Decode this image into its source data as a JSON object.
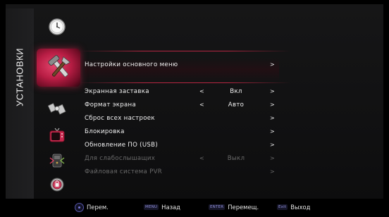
{
  "sidebar": {
    "title": "УСТАНОВКИ",
    "icons": [
      {
        "name": "clock-icon"
      },
      {
        "name": "tools-icon",
        "selected": true
      },
      {
        "name": "satellite-icon"
      },
      {
        "name": "tv-icon"
      },
      {
        "name": "remote-card-icon"
      },
      {
        "name": "lock-badge-icon"
      }
    ]
  },
  "menu": {
    "header_item": {
      "label": "Настройки основного меню",
      "arrow": ">"
    },
    "items": [
      {
        "label": "Экранная заставка",
        "left_arrow": "<",
        "value": "Вкл",
        "right_arrow": ">",
        "enabled": true
      },
      {
        "label": "Формат экрана",
        "left_arrow": "<",
        "value": "Авто",
        "right_arrow": ">",
        "enabled": true
      },
      {
        "label": "Сброс всех настроек",
        "left_arrow": "",
        "value": "",
        "right_arrow": ">",
        "enabled": true
      },
      {
        "label": "Блокировка",
        "left_arrow": "",
        "value": "",
        "right_arrow": ">",
        "enabled": true
      },
      {
        "label": "Обновление ПО (USB)",
        "left_arrow": "",
        "value": "",
        "right_arrow": ">",
        "enabled": true
      },
      {
        "label": "Для слабослышащих",
        "left_arrow": "<",
        "value": "Выкл",
        "right_arrow": ">",
        "enabled": false
      },
      {
        "label": "Файловая система PVR",
        "left_arrow": "",
        "value": "",
        "right_arrow": ">",
        "enabled": false
      }
    ]
  },
  "bottom_bar": {
    "move": {
      "label": "Перем."
    },
    "back": {
      "key": "MENU",
      "label": "Назад"
    },
    "enter": {
      "key": "ENTER",
      "label": "Перемещ."
    },
    "exit": {
      "key": "Exit",
      "label": "Выход"
    }
  },
  "colors": {
    "accent": "#c8284e",
    "background": "#141415",
    "text": "#f2f2f2",
    "disabled_text": "#6a6a6a"
  }
}
